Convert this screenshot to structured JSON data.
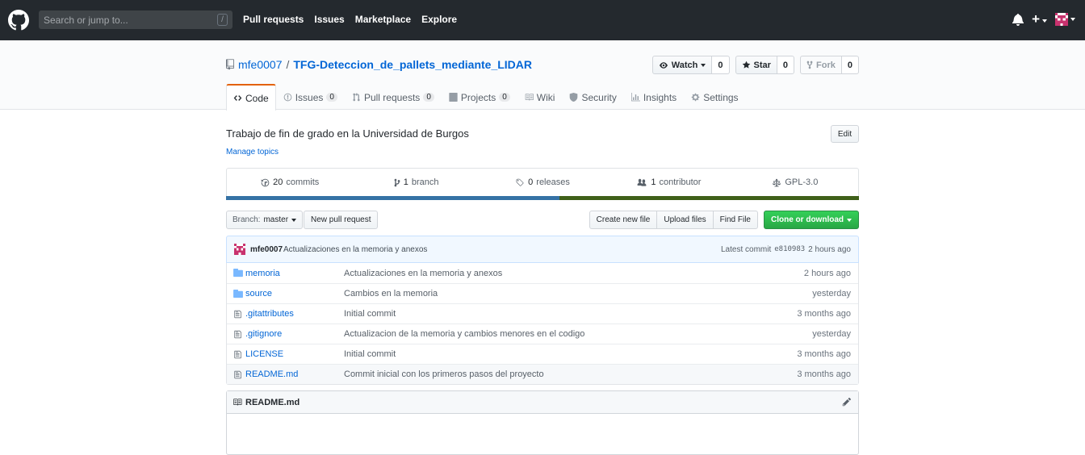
{
  "header": {
    "search_placeholder": "Search or jump to...",
    "search_shortcut": "/",
    "nav": [
      "Pull requests",
      "Issues",
      "Marketplace",
      "Explore"
    ],
    "plus": "+"
  },
  "repo": {
    "owner": "mfe0007",
    "separator": "/",
    "name": "TFG-Deteccion_de_pallets_mediante_LIDAR",
    "watch_label": "Watch",
    "watch_count": "0",
    "star_label": "Star",
    "star_count": "0",
    "fork_label": "Fork",
    "fork_count": "0"
  },
  "tabs": [
    {
      "label": "Code",
      "icon": "code-icon"
    },
    {
      "label": "Issues",
      "count": "0",
      "icon": "issue-icon"
    },
    {
      "label": "Pull requests",
      "count": "0",
      "icon": "pr-icon"
    },
    {
      "label": "Projects",
      "count": "0",
      "icon": "project-icon"
    },
    {
      "label": "Wiki",
      "icon": "book-icon"
    },
    {
      "label": "Security",
      "icon": "shield-icon"
    },
    {
      "label": "Insights",
      "icon": "graph-icon"
    },
    {
      "label": "Settings",
      "icon": "gear-icon"
    }
  ],
  "about": {
    "description": "Trabajo de fin de grado en la Universidad de Burgos",
    "manage_topics": "Manage topics",
    "edit": "Edit"
  },
  "summary": {
    "commits_num": "20",
    "commits_label": "commits",
    "branch_num": "1",
    "branch_label": "branch",
    "releases_num": "0",
    "releases_label": "releases",
    "contributor_num": "1",
    "contributor_label": "contributor",
    "license": "GPL-3.0",
    "language_colors": [
      "#3572a5",
      "#3f6019"
    ],
    "language_fractions": [
      0.527,
      0.473
    ]
  },
  "toolbar": {
    "branch_label": "Branch:",
    "branch_value": "master",
    "new_pr": "New pull request",
    "create_file": "Create new file",
    "upload_files": "Upload files",
    "find_file": "Find File",
    "clone": "Clone or download"
  },
  "latest_commit": {
    "author": "mfe0007",
    "message": "Actualizaciones en la memoria y anexos",
    "label": "Latest commit",
    "sha": "e810983",
    "age": "2 hours ago"
  },
  "files": [
    {
      "type": "dir",
      "name": "memoria",
      "message": "Actualizaciones en la memoria y anexos",
      "age": "2 hours ago"
    },
    {
      "type": "dir",
      "name": "source",
      "message": "Cambios en la memoria",
      "age": "yesterday"
    },
    {
      "type": "file",
      "name": ".gitattributes",
      "message": "Initial commit",
      "age": "3 months ago"
    },
    {
      "type": "file",
      "name": ".gitignore",
      "message": "Actualizacion de la memoria y cambios menores en el codigo",
      "age": "yesterday"
    },
    {
      "type": "file",
      "name": "LICENSE",
      "message": "Initial commit",
      "age": "3 months ago"
    },
    {
      "type": "file",
      "name": "README.md",
      "message": "Commit inicial con los primeros pasos del proyecto",
      "age": "3 months ago"
    }
  ],
  "readme": {
    "title": "README.md"
  }
}
